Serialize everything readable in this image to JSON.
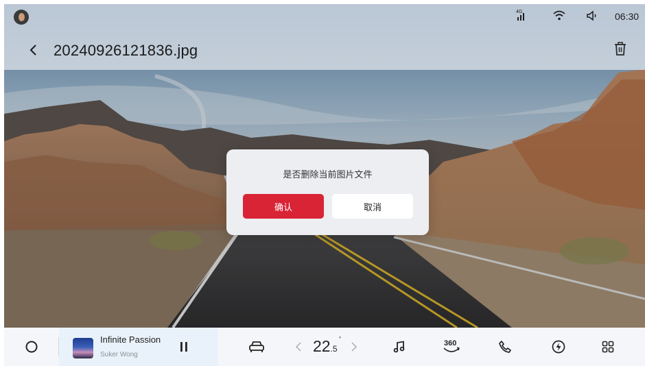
{
  "status_bar": {
    "network_label": "4G",
    "time": "06:30"
  },
  "header": {
    "title": "20240926121836.jpg"
  },
  "dialog": {
    "message": "是否删除当前图片文件",
    "confirm_label": "确认",
    "cancel_label": "取消",
    "confirm_color": "#d92436"
  },
  "dock": {
    "now_playing": {
      "title": "Infinite Passion",
      "artist": "Suker Wong"
    },
    "climate": {
      "temp_int": "22",
      "temp_dec": ".5",
      "unit": "°"
    },
    "icons": [
      "home-circle-icon",
      "pause-icon",
      "car-icon",
      "chevron-left-icon",
      "chevron-right-icon",
      "music-note-icon",
      "camera-360-icon",
      "phone-icon",
      "lightning-icon",
      "apps-grid-icon"
    ],
    "camera_label": "360"
  }
}
